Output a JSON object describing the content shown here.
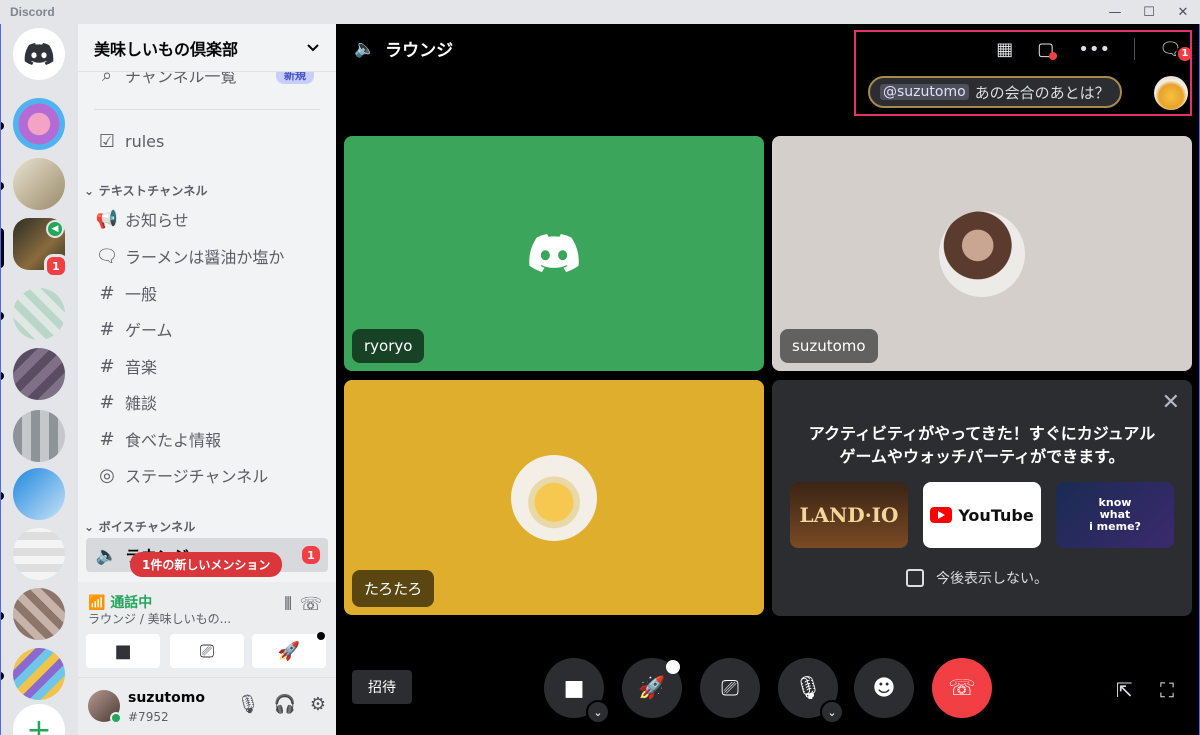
{
  "window": {
    "brand": "Discord",
    "controls": [
      "—",
      "☐",
      "✕"
    ]
  },
  "rail": {
    "home_icon": "discord-logo-icon",
    "unread_badge": "1",
    "add_label": "+"
  },
  "guild": {
    "name": "美味しいもの倶楽部",
    "dropdown_icon": "chevron-down-icon"
  },
  "channels": {
    "browse_label": "チャンネル一覧",
    "new_tag": "新規",
    "rules": "rules",
    "text_category": "テキストチャンネル",
    "text": [
      "お知らせ",
      "ラーメンは醤油か塩か",
      "一般",
      "ゲーム",
      "音楽",
      "雑談",
      "食べたよ情報",
      "ステージチャンネル"
    ],
    "voice_category": "ボイスチャンネル",
    "voice": "ラウンジ",
    "voice_badge": "1",
    "mention_bar": "1件の新しいメンション"
  },
  "voice_panel": {
    "status": "通話中",
    "sub": "ラウンジ / 美味しいもの..."
  },
  "user": {
    "name": "suzutomo",
    "tag": "#7952"
  },
  "stage": {
    "title": "ラウンジ",
    "inbox_badge": "1",
    "toast": {
      "mention": "@suzutomo",
      "text": "あの会合のあとは？"
    },
    "tiles": [
      {
        "name": "ryoryo",
        "color": "#3ba55c"
      },
      {
        "name": "suzutomo",
        "color": "#d4cfca"
      },
      {
        "name": "たろたろ",
        "color": "#dfae2c"
      }
    ],
    "activity": {
      "title": "アクティビティがやってきた！すぐにカジュアルゲームやウォッチパーティができます。",
      "cards": [
        "LAND·IO",
        "YouTube",
        "know\nwhat\ni meme?"
      ],
      "checkbox": "今後表示しない。"
    },
    "invite": "招待"
  }
}
